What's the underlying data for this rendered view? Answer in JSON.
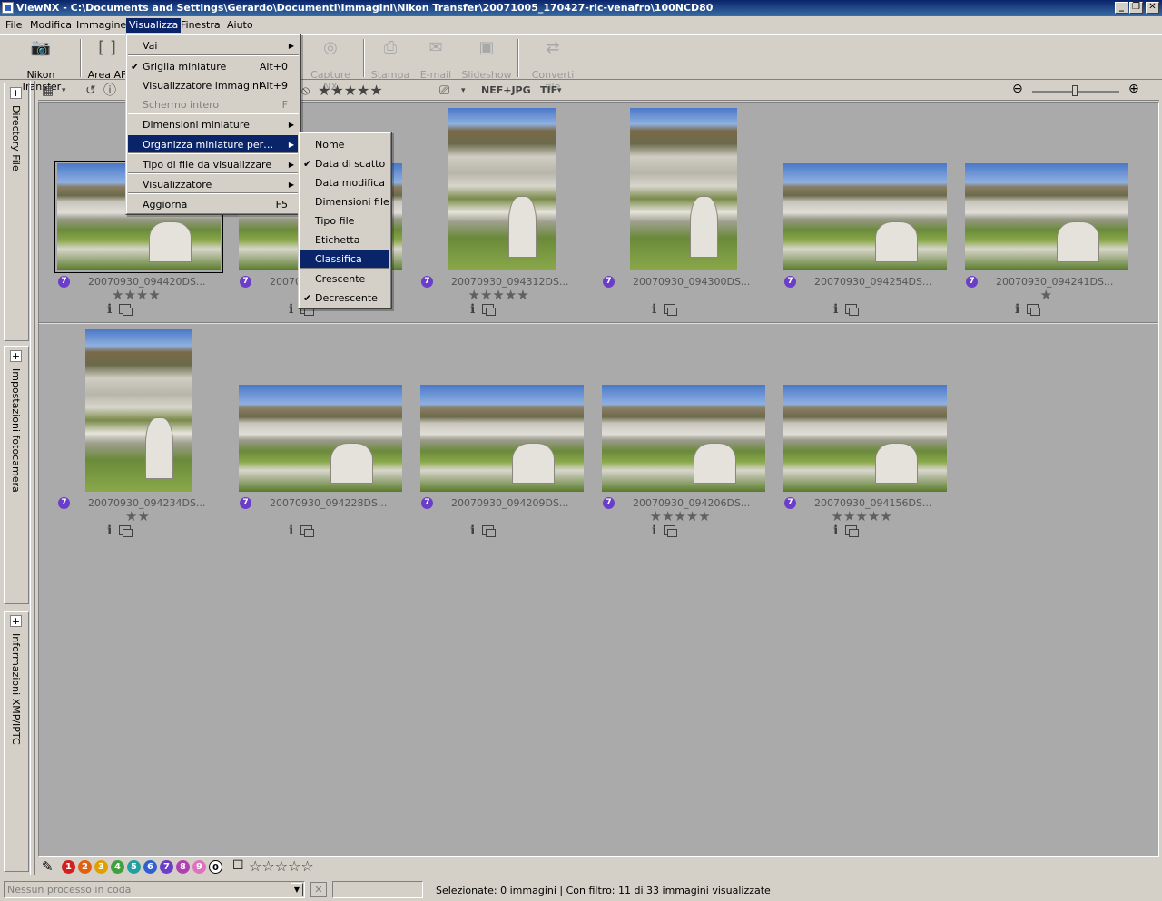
{
  "window": {
    "title": "ViewNX - C:\\Documents and Settings\\Gerardo\\Documenti\\Immagini\\Nikon Transfer\\20071005_170427-ric-venafro\\100NCD80",
    "min": "_",
    "max": "❐",
    "close": "✕"
  },
  "menubar": [
    "File",
    "Modifica",
    "Immagine",
    "Visualizza",
    "Finestra",
    "Aiuto"
  ],
  "toolbar": {
    "nikon_transfer": "Nikon Transfer",
    "area_af": "Area AF",
    "capture_nx": "Capture NX",
    "stampa": "Stampa",
    "email": "E-mail",
    "slideshow": "Slideshow",
    "converti": "Converti file"
  },
  "strip": {
    "nef_jpg": "NEF+JPG",
    "tif": "TIF"
  },
  "left_panels": [
    "Directory File",
    "Impostazioni fotocamera",
    "Informazioni XMP/IPTC"
  ],
  "visualizza_menu": {
    "items": [
      {
        "label": "Vai",
        "shortcut": "",
        "submenu": true
      },
      {
        "label": "Griglia miniature",
        "shortcut": "Alt+0",
        "checked": true
      },
      {
        "label": "Visualizzatore immagini",
        "shortcut": "Alt+9"
      },
      {
        "label": "Schermo intero",
        "shortcut": "F",
        "disabled": true
      },
      {
        "label": "Dimensioni miniature",
        "submenu": true
      },
      {
        "label": "Organizza miniature per…",
        "submenu": true,
        "highlighted": true
      },
      {
        "label": "Tipo di file da visualizzare",
        "submenu": true
      },
      {
        "label": "Visualizzatore",
        "submenu": true
      },
      {
        "label": "Aggiorna",
        "shortcut": "F5"
      }
    ]
  },
  "organizza_submenu": {
    "items": [
      {
        "label": "Nome"
      },
      {
        "label": "Data di scatto",
        "checked": true
      },
      {
        "label": "Data modifica"
      },
      {
        "label": "Dimensioni file"
      },
      {
        "label": "Tipo file"
      },
      {
        "label": "Etichetta"
      },
      {
        "label": "Classifica",
        "highlighted": true
      },
      {
        "label": "Crescente"
      },
      {
        "label": "Decrescente",
        "checked": true
      }
    ]
  },
  "thumbnails": [
    {
      "name": "20070930_094420DS...",
      "label": "7",
      "stars": "★★★★",
      "orientation": "landscape",
      "selected": true
    },
    {
      "name": "20070930_094415DS...",
      "label": "7",
      "stars": "",
      "orientation": "landscape"
    },
    {
      "name": "20070930_094312DS...",
      "label": "7",
      "stars": "★★★★★",
      "orientation": "portrait"
    },
    {
      "name": "20070930_094300DS...",
      "label": "7",
      "stars": "",
      "orientation": "portrait"
    },
    {
      "name": "20070930_094254DS...",
      "label": "7",
      "stars": "",
      "orientation": "landscape"
    },
    {
      "name": "20070930_094241DS...",
      "label": "7",
      "stars": "★",
      "orientation": "landscape"
    },
    {
      "name": "20070930_094234DS...",
      "label": "7",
      "stars": "★★",
      "orientation": "portrait"
    },
    {
      "name": "20070930_094228DS...",
      "label": "7",
      "stars": "",
      "orientation": "landscape"
    },
    {
      "name": "20070930_094209DS...",
      "label": "7",
      "stars": "",
      "orientation": "landscape"
    },
    {
      "name": "20070930_094206DS...",
      "label": "7",
      "stars": "★★★★★",
      "orientation": "landscape"
    },
    {
      "name": "20070930_094156DS...",
      "label": "7",
      "stars": "★★★★★",
      "orientation": "landscape"
    }
  ],
  "info_glyph": "i",
  "label_colors": [
    {
      "n": "1",
      "color": "#d02020"
    },
    {
      "n": "2",
      "color": "#e06010"
    },
    {
      "n": "3",
      "color": "#e0a000"
    },
    {
      "n": "4",
      "color": "#40a040"
    },
    {
      "n": "5",
      "color": "#20a0a0"
    },
    {
      "n": "6",
      "color": "#3060d0"
    },
    {
      "n": "7",
      "color": "#6a3ec8"
    },
    {
      "n": "8",
      "color": "#b040b0"
    },
    {
      "n": "9",
      "color": "#e070c0"
    },
    {
      "n": "0",
      "color": "#ffffff"
    }
  ],
  "rating_stars": "☆☆☆☆☆",
  "status": {
    "queue": "Nessun processo in coda",
    "selection": "Selezionate: 0 immagini | Con filtro: 11 di 33 immagini visualizzate"
  }
}
